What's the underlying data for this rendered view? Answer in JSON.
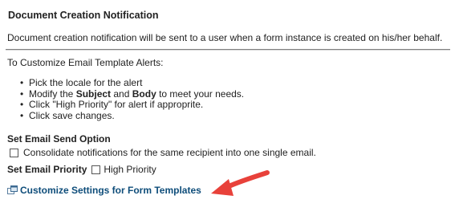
{
  "section": {
    "title": "Document Creation Notification",
    "description": "Document creation notification will be sent to a user when a form instance is created on his/her behalf."
  },
  "instructions": {
    "intro": "To Customize Email Template Alerts:",
    "items": [
      {
        "text": "Pick the locale for the alert"
      },
      {
        "pre": "Modify the ",
        "bold1": "Subject",
        "mid": " and ",
        "bold2": "Body",
        "post": " to meet your needs."
      },
      {
        "text": "Click \"High Priority\" for alert if approprite."
      },
      {
        "text": "Click save changes."
      }
    ]
  },
  "send_option": {
    "title": "Set Email Send Option",
    "consolidate_label": "Consolidate notifications for the same recipient into one single email.",
    "consolidate_checked": false
  },
  "priority": {
    "title": "Set Email Priority",
    "high_priority_label": "High Priority",
    "high_priority_checked": false
  },
  "link": {
    "label": "Customize Settings for Form Templates",
    "icon": "new-window-icon"
  },
  "annotation": {
    "arrow_color": "#e8413a"
  },
  "colors": {
    "link": "#0e4d7a",
    "text": "#222222"
  }
}
